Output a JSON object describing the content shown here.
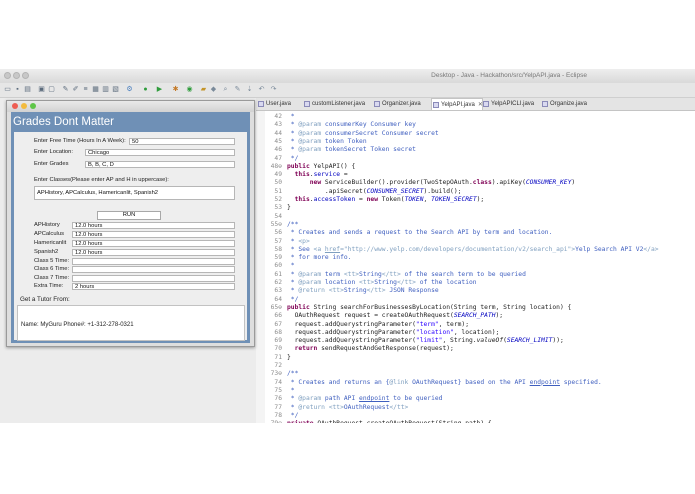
{
  "eclipse": {
    "title": "Desktop - Java - Hackathon/src/YelpAPI.java - Eclipse",
    "tabs": [
      {
        "label": "User.java"
      },
      {
        "label": "customListener.java"
      },
      {
        "label": "Organizer.java"
      },
      {
        "label": "YelpAPI.java",
        "active": true
      },
      {
        "label": "YelpAPICLI.java"
      },
      {
        "label": "Organize.java"
      }
    ],
    "close_glyph": "✕"
  },
  "app": {
    "title": "Grades Dont Matter",
    "free_time_label": "Enter Free Time (Hours In A Week):",
    "free_time_value": "50",
    "location_label": "Enter Location:",
    "location_value": "Chicago",
    "grades_label": "Enter Grades",
    "grades_value": "B, B, C, D",
    "classes_label": "Enter Classes(Please enter AP and H in uppercase):",
    "classes_value": "APHistory, APCalculus, Hamericanlit, Spanish2",
    "run_label": "RUN",
    "class_rows": [
      {
        "name": "APHistory",
        "hours": "12.0 hours"
      },
      {
        "name": "APCalculus",
        "hours": "12.0 hours"
      },
      {
        "name": "Hamericanlit",
        "hours": "12.0 hours"
      },
      {
        "name": "Spanish2",
        "hours": "12.0 hours"
      },
      {
        "name": "Class 5 Time:",
        "hours": ""
      },
      {
        "name": "Class 6 Time:",
        "hours": ""
      },
      {
        "name": "Class 7 Time:",
        "hours": ""
      },
      {
        "name": "Extra Time:",
        "hours": "2 hours"
      }
    ],
    "tutor_label": "Get a Tutor From:",
    "tutor_result": "Name: MyGuru  Phone#:  +1-312-278-0321"
  },
  "colors": {
    "app_body": "#6f90b6",
    "keyword": "#7f0055",
    "javadoc": "#3f5fbf",
    "string": "#2a00ff",
    "field": "#0000c0",
    "close_dot": "#ee5d52",
    "minimize_dot": "#f3bb3e",
    "zoom_dot": "#5fc648"
  },
  "code_lines": [
    {
      "num": "42",
      "html": "<span class='cm'> *</span>"
    },
    {
      "num": "43",
      "html": "<span class='cm'> * <span class='tag'>@param</span> consumerKey Consumer key</span>"
    },
    {
      "num": "44",
      "html": "<span class='cm'> * <span class='tag'>@param</span> consumerSecret Consumer secret</span>"
    },
    {
      "num": "45",
      "html": "<span class='cm'> * <span class='tag'>@param</span> token Token</span>"
    },
    {
      "num": "46",
      "html": "<span class='cm'> * <span class='tag'>@param</span> tokenSecret Token secret</span>"
    },
    {
      "num": "47",
      "html": "<span class='cm'> */</span>"
    },
    {
      "num": "48⊖",
      "html": "<span class='kw'>public</span> YelpAPI() {"
    },
    {
      "num": "49",
      "html": "  <span class='kw'>this</span>.<span class='fi'>service</span> ="
    },
    {
      "num": "50",
      "html": "      <span class='kw'>new</span> ServiceBuilder().provider(TwoStepOAuth.<span class='kw'>class</span>).apiKey(<span class='sf'>CONSUMER_KEY</span>)"
    },
    {
      "num": "51",
      "html": "          .apiSecret(<span class='sf'>CONSUMER_SECRET</span>).build();"
    },
    {
      "num": "52",
      "html": "  <span class='kw'>this</span>.<span class='fi'>accessToken</span> = <span class='kw'>new</span> Token(<span class='sf'>TOKEN</span>, <span class='sf'>TOKEN_SECRET</span>);"
    },
    {
      "num": "53",
      "html": "}"
    },
    {
      "num": "54",
      "html": ""
    },
    {
      "num": "55⊖",
      "html": "<span class='cm'>/**</span>"
    },
    {
      "num": "56",
      "html": "<span class='cm'> * Creates and sends a request to the Search API by term and location.</span>"
    },
    {
      "num": "57",
      "html": "<span class='cm'> * <span class='tag'>&lt;p&gt;</span></span>"
    },
    {
      "num": "58",
      "html": "<span class='cm'> * See <span class='tag'>&lt;a <u>href</u>=\"http://www.yelp.com/developers/documentation/v2/search_api\"&gt;</span>Yelp Search API V2<span class='tag'>&lt;/a&gt;</span></span>"
    },
    {
      "num": "59",
      "html": "<span class='cm'> * for more info.</span>"
    },
    {
      "num": "60",
      "html": "<span class='cm'> *</span>"
    },
    {
      "num": "61",
      "html": "<span class='cm'> * <span class='tag'>@param</span> term <span class='tag'>&lt;tt&gt;</span>String<span class='tag'>&lt;/tt&gt;</span> of the search term to be queried</span>"
    },
    {
      "num": "62",
      "html": "<span class='cm'> * <span class='tag'>@param</span> location <span class='tag'>&lt;tt&gt;</span>String<span class='tag'>&lt;/tt&gt;</span> of the location</span>"
    },
    {
      "num": "63",
      "html": "<span class='cm'> * <span class='tag'>@return</span> <span class='tag'>&lt;tt&gt;</span>String<span class='tag'>&lt;/tt&gt;</span> JSON Response</span>"
    },
    {
      "num": "64",
      "html": "<span class='cm'> */</span>"
    },
    {
      "num": "65⊖",
      "html": "<span class='kw'>public</span> String searchForBusinessesByLocation(String term, String location) {"
    },
    {
      "num": "66",
      "html": "  OAuthRequest request = createOAuthRequest(<span class='sf'>SEARCH_PATH</span>);"
    },
    {
      "num": "67",
      "html": "  request.addQuerystringParameter(<span class='st'>\"term\"</span>, term);"
    },
    {
      "num": "68",
      "html": "  request.addQuerystringParameter(<span class='st'>\"location\"</span>, location);"
    },
    {
      "num": "69",
      "html": "  request.addQuerystringParameter(<span class='st'>\"limit\"</span>, String.<i>valueOf</i>(<span class='sf'>SEARCH_LIMIT</span>));"
    },
    {
      "num": "70",
      "html": "  <span class='kw'>return</span> sendRequestAndGetResponse(request);"
    },
    {
      "num": "71",
      "html": "}"
    },
    {
      "num": "72",
      "html": ""
    },
    {
      "num": "73⊖",
      "html": "<span class='cm'>/**</span>"
    },
    {
      "num": "74",
      "html": "<span class='cm'> * Creates and returns an {<span class='tag'>@link</span> OAuthRequest} based on the API <u>endpoint</u> specified.</span>"
    },
    {
      "num": "75",
      "html": "<span class='cm'> *</span>"
    },
    {
      "num": "76",
      "html": "<span class='cm'> * <span class='tag'>@param</span> path API <u>endpoint</u> to be queried</span>"
    },
    {
      "num": "77",
      "html": "<span class='cm'> * <span class='tag'>@return</span> <span class='tag'>&lt;tt&gt;</span>OAuthRequest<span class='tag'>&lt;/tt&gt;</span></span>"
    },
    {
      "num": "78",
      "html": "<span class='cm'> */</span>"
    },
    {
      "num": "79⊖",
      "html": "<span class='kw'>private</span> OAuthRequest createOAuthRequest(String path) {"
    }
  ]
}
